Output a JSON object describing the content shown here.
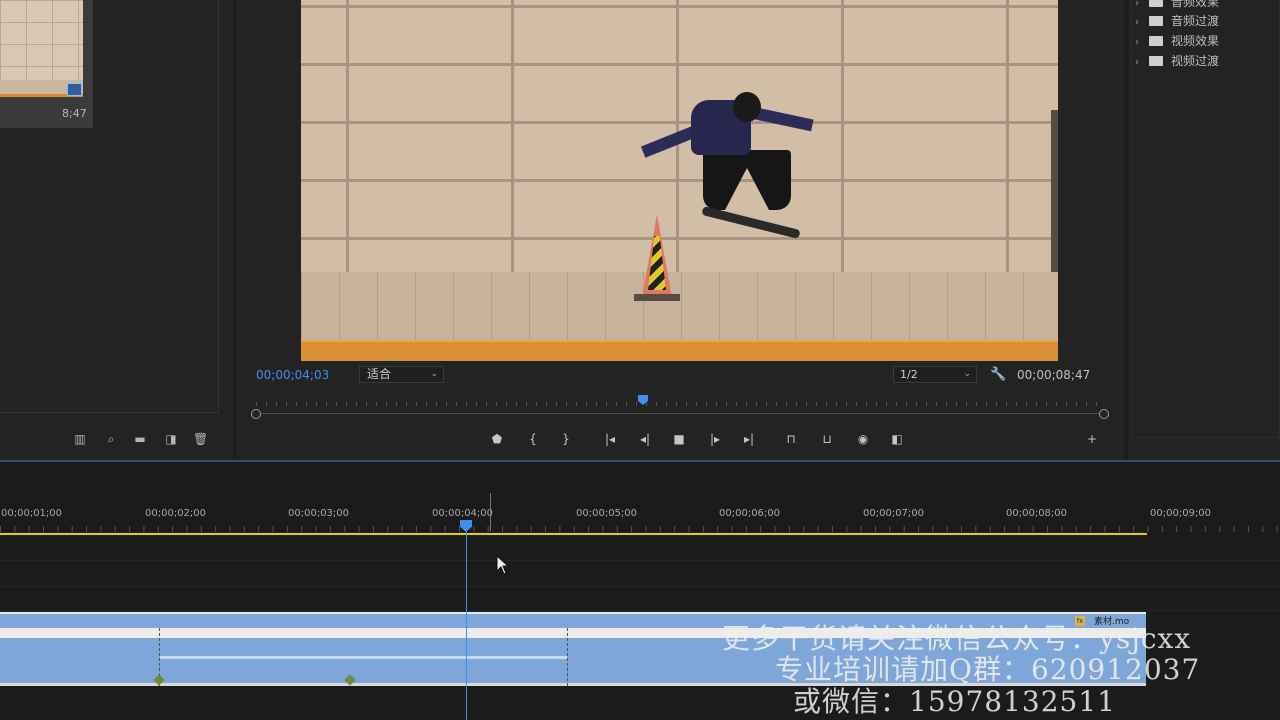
{
  "project": {
    "clip_duration": "8;47",
    "tools": [
      "list-view-icon",
      "search-icon",
      "folder-icon",
      "new-item-icon",
      "trash-icon"
    ]
  },
  "monitor": {
    "current_timecode": "00;00;04;03",
    "fit_value": "适合",
    "resolution_value": "1/2",
    "duration_timecode": "00;00;08;47",
    "transport_icons": [
      "add-marker-icon",
      "mark-in-icon",
      "mark-out-icon",
      "go-to-in-icon",
      "step-back-icon",
      "stop-icon",
      "play-icon",
      "go-to-out-icon",
      "lift-icon",
      "extract-icon",
      "export-frame-icon",
      "comparison-view-icon",
      "add-button-icon"
    ]
  },
  "effects": {
    "items": [
      {
        "label": "音频效果"
      },
      {
        "label": "音频过渡"
      },
      {
        "label": "视频效果"
      },
      {
        "label": "视频过渡"
      }
    ]
  },
  "timeline": {
    "ruler_labels": [
      "00;00;01;00",
      "00;00;02;00",
      "00;00;03;00",
      "00;00;04;00",
      "00;00;05;00",
      "00;00;06;00",
      "00;00;07;00",
      "00;00;08;00",
      "00;00;09;00"
    ],
    "clip_label": "素材.mo",
    "clip_badge": "fx"
  },
  "watermark": {
    "line1": "更多干货请关注微信公众号：ysjcxx",
    "line2": "专业培训请加Q群：620912037",
    "line3": "或微信：15978132511"
  },
  "colors": {
    "accent": "#3d8ff0",
    "work_area": "#e3d000",
    "clip": "#7ea6d8"
  }
}
